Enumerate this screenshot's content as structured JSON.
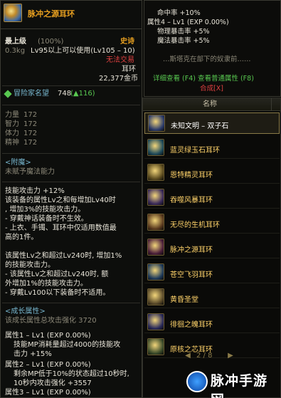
{
  "tooltip": {
    "title": "脉冲之源耳环",
    "grade": "最上级",
    "grade_pct": "(100%)",
    "rarity": "史诗",
    "weight": "0.3kg",
    "level_req": "Lv95以上可以使用(Lv105 – 10)",
    "trade": "无法交易",
    "slot": "耳环",
    "price": "22,377金币",
    "adventure": "冒险家名望",
    "adventure_value": "748",
    "adventure_bonus": "(▲116)",
    "stats": [
      {
        "name": "力量",
        "value": "172"
      },
      {
        "name": "智力",
        "value": "172"
      },
      {
        "name": "体力",
        "value": "172"
      },
      {
        "name": "精神",
        "value": "172"
      }
    ],
    "enchant_title": "<附魔>",
    "enchant_desc": "未赋予魔法能力",
    "effect_lines": [
      "技能攻击力 +12%",
      "该装备的属性Lv之和每增加Lv40时",
      ", 增加3%的技能攻击力。",
      "- 穿戴神话装备时不生效。",
      "- 上衣、手镯、耳环中仅适用数值最",
      "高的1件。",
      "",
      "该属性Lv之和超过Lv240时, 增加1%",
      "的技能攻击力。",
      "- 该属性Lv之和超过Lv240时, 额",
      "外增加1%的技能攻击力。",
      "- 穿戴Lv100以下装备时不适用。"
    ],
    "growth_title": "<成长属性>",
    "growth_total": "该成长属性总攻击强化 3720",
    "attr1": "属性1 – Lv1 (EXP 0.00%)",
    "attr1_lines": [
      "技能MP消耗量超过4000的技能攻",
      "击力 +15%"
    ],
    "attr2": "属性2 – Lv1 (EXP 0.00%)",
    "attr2_lines": [
      "剩余MP低于10%的状态超过10秒时,",
      "10秒内攻击强化 +3557"
    ],
    "attr3": "属性3 – Lv1 (EXP 0.00%)"
  },
  "info_panel": {
    "lines": [
      "命中率 +10%",
      "属性4 – Lv1 (EXP 0.00%)",
      "物理暴击率 +5%",
      "魔法暴击率 +5%"
    ],
    "flavor": "…斯塔克在部下的奴隶前……",
    "detail_link": "详细查看 (F4) 查看普通属性 (F8)",
    "craft_link": "合成[X]"
  },
  "list": {
    "header_name": "名称",
    "items": [
      {
        "label": "未知文明 – 双子石",
        "selected": true
      },
      {
        "label": "蓝灵绿玉石耳环",
        "selected": false
      },
      {
        "label": "恩特精灵耳环",
        "selected": false
      },
      {
        "label": "吞噬风暴耳环",
        "selected": false
      },
      {
        "label": "无尽的生机耳环",
        "selected": false
      },
      {
        "label": "脉冲之源耳环",
        "selected": false
      },
      {
        "label": "苍空飞羽耳环",
        "selected": false
      },
      {
        "label": "黄昏圣堂",
        "selected": false
      },
      {
        "label": "徘徊之魄耳环",
        "selected": false
      },
      {
        "label": "原核之芯耳环",
        "selected": false
      }
    ],
    "page": "2 / 8"
  },
  "watermark": "脉冲手游网",
  "colors": {
    "gold": "#e8a020",
    "red": "#e04040",
    "green": "#58c850",
    "panel_bg": "#0d0e0c"
  }
}
